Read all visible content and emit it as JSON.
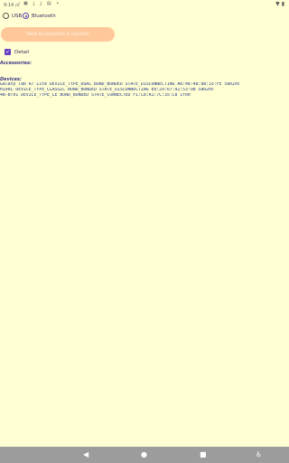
{
  "status_bar": {
    "time": "9:14 ㎡",
    "left_icons": "▣ ⤓ ⤓ ▤ •",
    "right_icons": "▼ ▮"
  },
  "connection": {
    "options": [
      {
        "label": "USB",
        "checked": false
      },
      {
        "label": "Bluetooth",
        "checked": true
      }
    ]
  },
  "actions": {
    "view_button": "View Accessories & Devices"
  },
  "detail": {
    "label": "Detail",
    "checked": true
  },
  "sections": {
    "accessories_title": "Accessories:",
    "devices_title": "Devices:"
  },
  "devices": {
    "lines": [
      "Galaxy Tab A7 Lite  DEVICE_TYPE_DUAL  BOND_BONDED  STATE_DISCONNECTING A8:48:48:9B:33:FE 5a020c",
      "H190L  DEVICE_TYPE_CLASSIC BOND_BONDED  STATE_DISCONNECTING E0:29:67:92:53:98 5a020c",
      "4B-BT01 DEVICE_TYPE_LE BOND_BONDED  STATE_CONNECTED   F1:C8:A1:7C:35:C8 1f00"
    ]
  },
  "navigation": {
    "icons": [
      "back-icon",
      "home-icon",
      "recents-icon",
      "accessibility-icon"
    ]
  }
}
